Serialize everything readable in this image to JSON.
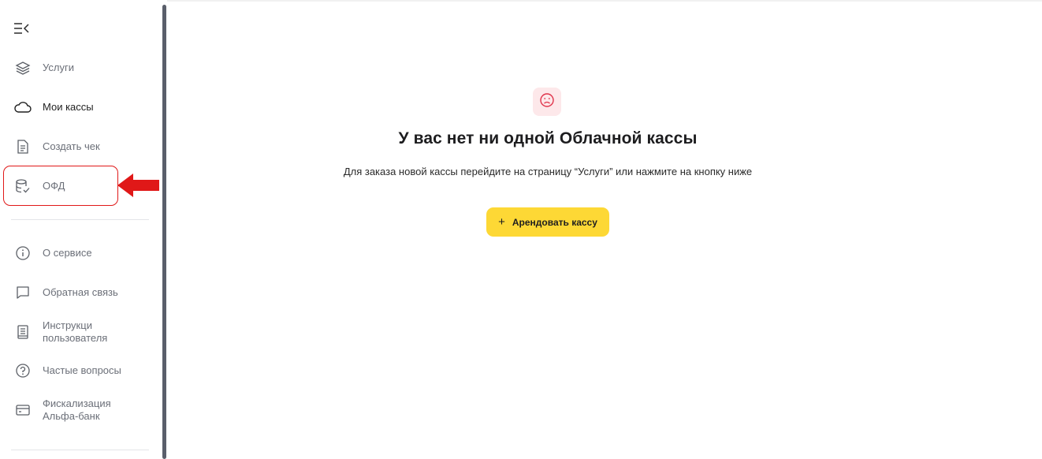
{
  "sidebar": {
    "primary_items": [
      {
        "label": "Услуги",
        "icon": "layers-icon"
      },
      {
        "label": "Мои кассы",
        "icon": "cloud-icon"
      },
      {
        "label": "Создать чек",
        "icon": "document-icon"
      },
      {
        "label": "ОФД",
        "icon": "database-check-icon"
      }
    ],
    "secondary_items": [
      {
        "label": "О сервисе",
        "icon": "info-icon"
      },
      {
        "label": "Обратная связь",
        "icon": "chat-icon"
      },
      {
        "label": "Инструкци\nпользователя",
        "icon": "book-icon"
      },
      {
        "label": "Частые вопросы",
        "icon": "question-icon"
      },
      {
        "label": "Фискализация\nАльфа-банк",
        "icon": "card-icon"
      }
    ],
    "active_item": "Мои кассы"
  },
  "main": {
    "empty_icon": "sad-face-icon",
    "title": "У вас нет ни одной Облачной кассы",
    "subtitle": "Для заказа новой кассы перейдите на страницу “Услуги” или нажмите на кнопку ниже",
    "button_label": "Арендовать кассу"
  },
  "colors": {
    "accent_button": "#fdd835",
    "highlight": "#e01818",
    "empty_badge_bg": "#fde8ea"
  }
}
